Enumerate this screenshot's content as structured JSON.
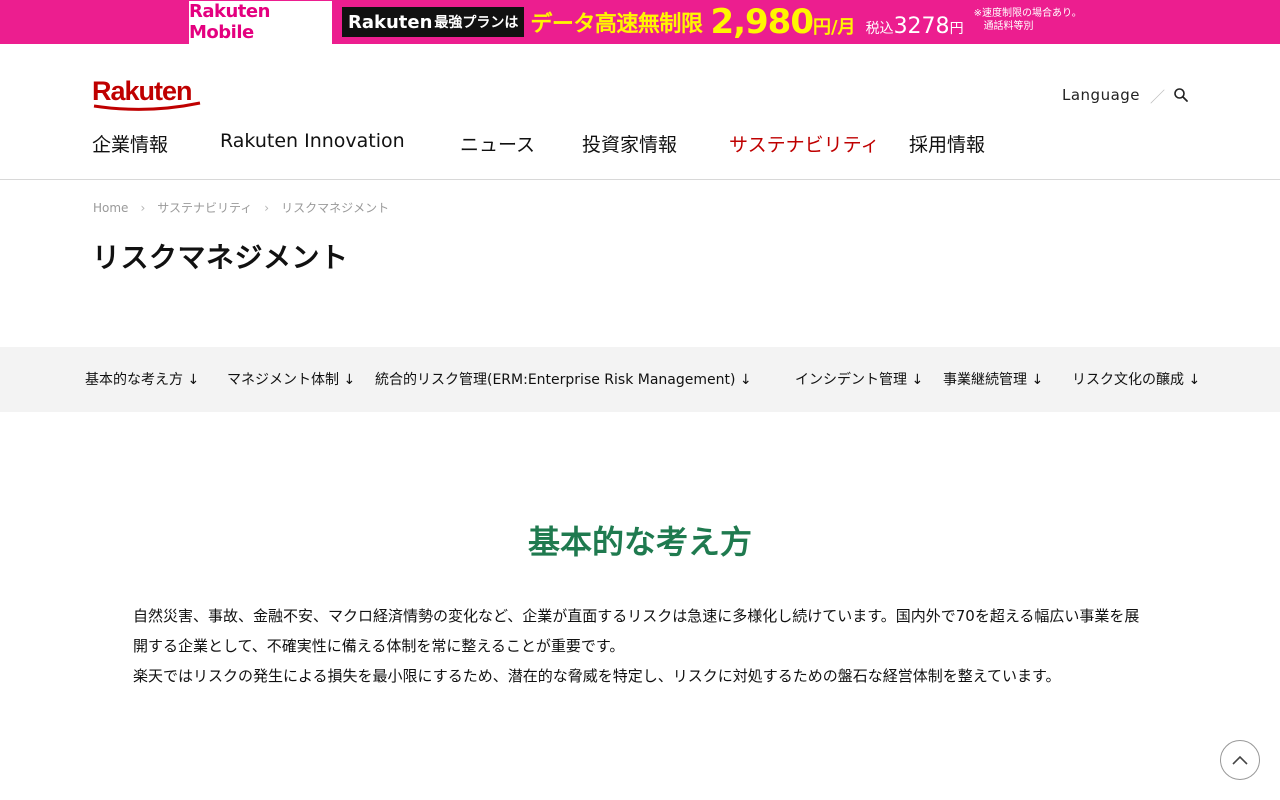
{
  "banner": {
    "brand": "Rakuten Mobile",
    "plan_name": "Rakuten",
    "plan_suffix": "最強プランは",
    "headline": "データ高速無制限",
    "price": "2,980",
    "price_unit": "円/月",
    "tax_label": "税込",
    "tax_price": "3278",
    "tax_unit": "円",
    "note_line1": "※速度制限の場合あり。",
    "note_line2": "通話料等別",
    "colors": {
      "background": "#ec1e8f",
      "highlight": "#fff600"
    }
  },
  "header": {
    "logo_text": "Rakuten",
    "language_label": "Language",
    "separator": "／",
    "nav": [
      {
        "label": "企業情報"
      },
      {
        "label": "Rakuten Innovation"
      },
      {
        "label": "ニュース"
      },
      {
        "label": "投資家情報"
      },
      {
        "label": "サステナビリティ",
        "active": true
      },
      {
        "label": "採用情報"
      }
    ],
    "colors": {
      "brand": "#bf0000"
    }
  },
  "breadcrumb": {
    "items": [
      "Home",
      "サステナビリティ",
      "リスクマネジメント"
    ],
    "separator": "›"
  },
  "page_title": "リスクマネジメント",
  "anchor_nav": [
    "基本的な考え方 ↓",
    "マネジメント体制 ↓",
    "統合的リスク管理(ERM:Enterprise Risk Management) ↓",
    "インシデント管理 ↓",
    "事業継続管理 ↓",
    "リスク文化の醸成 ↓"
  ],
  "section": {
    "heading": "基本的な考え方",
    "paragraph1": "自然災害、事故、金融不安、マクロ経済情勢の変化など、企業が直面するリスクは急速に多様化し続けています。国内外で70を超える幅広い事業を展開する企業として、不確実性に備える体制を常に整えることが重要です。",
    "paragraph2": "楽天ではリスクの発生による損失を最小限にするため、潜在的な脅威を特定し、リスクに対処するための盤石な経営体制を整えています。",
    "colors": {
      "heading": "#1f7a4f"
    }
  },
  "icons": {
    "search": "search-icon",
    "back_to_top": "chevron-up-icon"
  }
}
